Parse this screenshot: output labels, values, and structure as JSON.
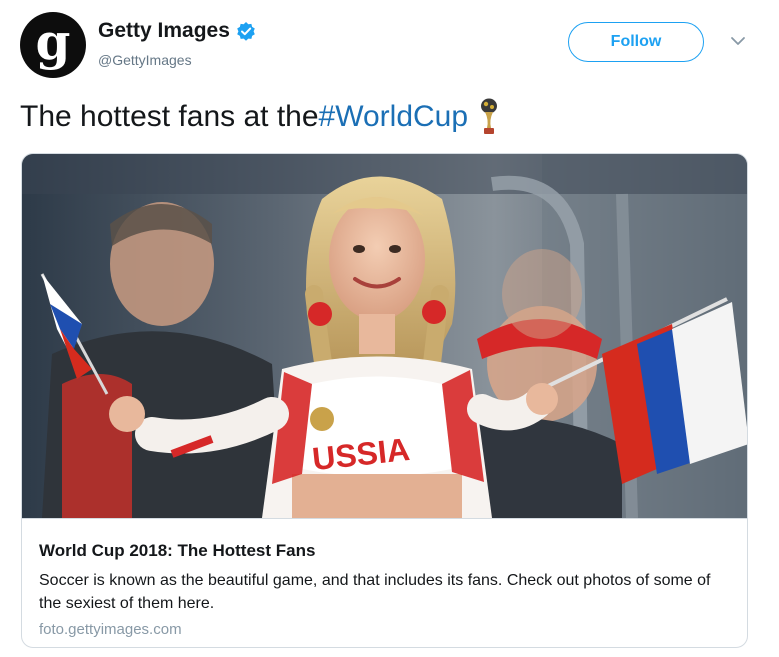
{
  "account": {
    "display_name": "Getty Images",
    "handle": "@GettyImages",
    "avatar_letter": "g",
    "verified_icon": "verified-badge-icon"
  },
  "actions": {
    "follow_label": "Follow",
    "menu_icon": "chevron-down-icon"
  },
  "tweet": {
    "text": "The hottest fans at the ",
    "hashtag": "#WorldCup",
    "emoji_icon": "world-cup-trophy-icon"
  },
  "card": {
    "title": "World Cup 2018: The Hottest Fans",
    "description": "Soccer is known as the beautiful game, and that includes its fans. Check out photos of some of the sexiest of them here.",
    "domain": "foto.gettyimages.com",
    "photo_shirt_text": "USSIA"
  },
  "colors": {
    "accent": "#1da1f2",
    "hashtag": "#1b6fb5",
    "flag_white": "#ffffff",
    "flag_blue": "#1f4fb0",
    "flag_red": "#d52b1e"
  }
}
